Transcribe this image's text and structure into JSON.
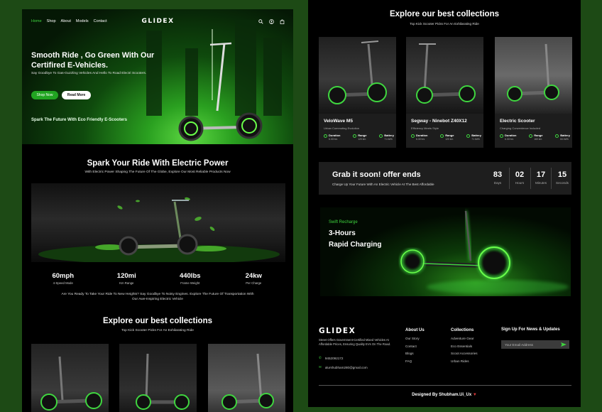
{
  "colors": {
    "accent": "#3fd63f",
    "bg": "#1d4a15",
    "panel": "#000000"
  },
  "nav": {
    "links": [
      "Home",
      "Shop",
      "About",
      "Models",
      "Contact"
    ],
    "logo": "GLIDEX",
    "icons": [
      "search-icon",
      "user-icon",
      "bag-icon"
    ]
  },
  "hero": {
    "title": "Smooth Ride , Go Green With Our Certifired E-Vehicles.",
    "subtitle": "Say Goodbye To Gas-Guzzling Vehicles And Hello To Road Electri Scooters.",
    "shop_label": "Shop Now",
    "read_label": "Read More",
    "tagline": "Spark The Future With Eco Friendly E-Scooters"
  },
  "power": {
    "title": "Spark Your Ride With Electric Power",
    "subtitle": "With Electric Power Shaping The Future Of The Globe, Explore Our Most Reliable Products Now",
    "stats": [
      {
        "value": "60mph",
        "label": "4-Speed Mode"
      },
      {
        "value": "120mi",
        "label": "Km Range"
      },
      {
        "value": "440lbs",
        "label": "Frame Weight"
      },
      {
        "value": "24kw",
        "label": "Per Charge"
      }
    ],
    "paragraph": "Are You Ready To Take Your Ride To New Heights? Say Goodbye To Noisy Engines. Explore The Future Of Transportation With Our Awe-Inspiring Electric Vehicle"
  },
  "collections_left": {
    "title": "Explore our best collections",
    "subtitle": "Top Kick Scooter Picks For An Exhilarating Ride"
  },
  "collections_right": {
    "title": "Explore our best collections",
    "subtitle": "Top Kick Scooter Picks For An Exhilarating Ride",
    "cards": [
      {
        "name": "VeloWave M5",
        "desc": "Urban Commuting Evolution",
        "specs": [
          {
            "k": "Duration",
            "v": "6.30 hrs"
          },
          {
            "k": "Range",
            "v": "120 km"
          },
          {
            "k": "Battery",
            "v": "71 kWh"
          }
        ]
      },
      {
        "name": "Segway - Ninebot Z40X12",
        "desc": "Efficiency Meets Style",
        "specs": [
          {
            "k": "Duration",
            "v": "6.30 hrs"
          },
          {
            "k": "Range",
            "v": "120 km"
          },
          {
            "k": "Battery",
            "v": "71 kWh"
          }
        ]
      },
      {
        "name": "Electric Scooter",
        "desc": "Charging Convenience Included",
        "specs": [
          {
            "k": "Duration",
            "v": "6.30 hrs"
          },
          {
            "k": "Range",
            "v": "160 km"
          },
          {
            "k": "Battery",
            "v": "84 kWh"
          }
        ]
      }
    ]
  },
  "offer": {
    "title": "Grab it soon! offer ends",
    "subtitle": "Charge Up Your Future With An Electric Vehicle At The Best Affordable",
    "countdown": [
      {
        "n": "83",
        "u": "Days"
      },
      {
        "n": "02",
        "u": "Hours"
      },
      {
        "n": "17",
        "u": "Minutes"
      },
      {
        "n": "15",
        "u": "Seconds"
      }
    ]
  },
  "charging": {
    "tag": "Swift Recharge",
    "line1": "3-Hours",
    "line2": "Rapid Charging"
  },
  "footer": {
    "logo": "GLIDEX",
    "desc": "Street Offers Government-Certified Mixed Vehicles At Affordable Prices, Ensuring Quality EVs On The Road.",
    "phone": "9452092172",
    "email": "alurshubham280@gmail.com",
    "about": {
      "title": "About Us",
      "items": [
        "Our Story",
        "Contact",
        "Blogs",
        "FAQ"
      ]
    },
    "collections": {
      "title": "Collections",
      "items": [
        "Adventure Gear",
        "Eco Essentials",
        "Scoot Accessories",
        "Urban Rides"
      ]
    },
    "newsletter": {
      "title": "Sign Up For News & Updates",
      "placeholder": "Your Email Address"
    },
    "credit": "Designed By Shubham.Ui_Ux"
  }
}
